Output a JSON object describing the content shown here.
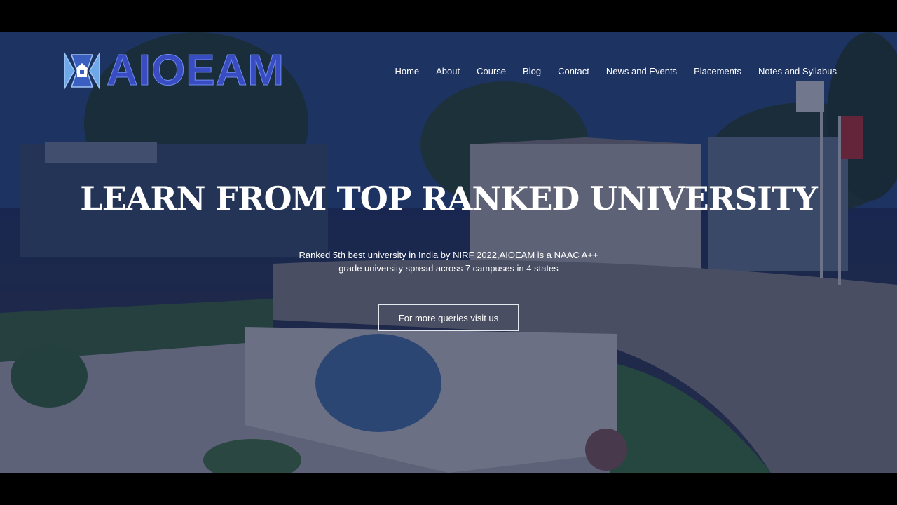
{
  "brand": {
    "name": "AIOEAM"
  },
  "nav": {
    "items": [
      {
        "label": "Home"
      },
      {
        "label": "About"
      },
      {
        "label": "Course"
      },
      {
        "label": "Blog"
      },
      {
        "label": "Contact"
      },
      {
        "label": "News and Events"
      },
      {
        "label": "Placements"
      },
      {
        "label": "Notes and Syllabus"
      }
    ]
  },
  "hero": {
    "headline": "LEARN FROM TOP RANKED UNIVERSITY",
    "subtext": "Ranked 5th best university in India by NIRF 2022,AIOEAM is a NAAC A++ grade university spread across 7 campuses in 4 states",
    "cta_label": "For more queries visit us"
  },
  "colors": {
    "overlay": "#1e2e5f",
    "logo": "#3a4cc2",
    "text": "#ffffff"
  },
  "icons": {
    "logo_mark": "shield-house-icon"
  }
}
